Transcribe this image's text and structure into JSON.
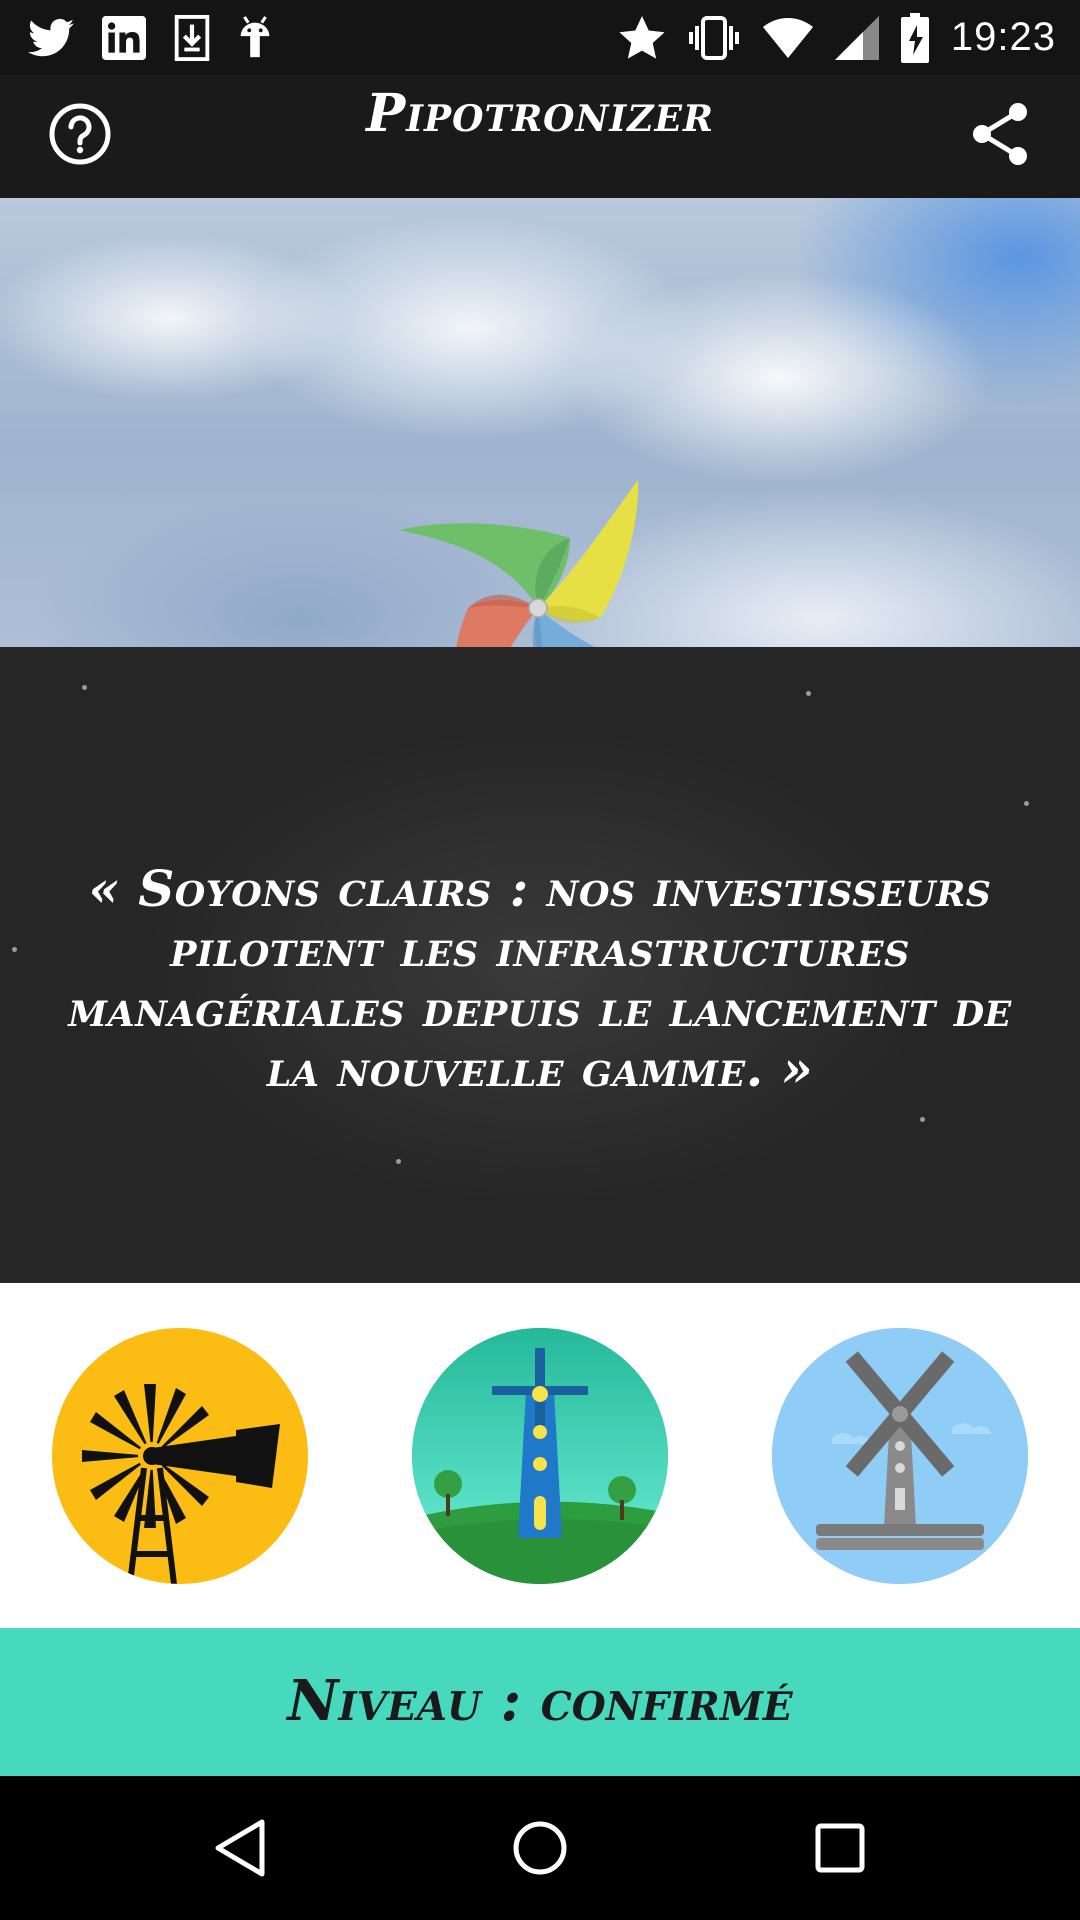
{
  "status_bar": {
    "time": "19:23",
    "icons": [
      "twitter-icon",
      "linkedin-icon",
      "download-icon",
      "android-icon",
      "star-icon",
      "vibrate-icon",
      "wifi-icon",
      "signal-icon",
      "battery-charging-icon"
    ]
  },
  "app_bar": {
    "title": "Pipotronizer",
    "help_icon": "help-circle-icon",
    "share_icon": "share-icon"
  },
  "quote": {
    "text": "« Soyons clairs : nos investisseurs pilotent les infrastructures managériales depuis le lancement de la nouvelle gamme. »"
  },
  "levels": {
    "items": [
      {
        "icon": "windpump-icon",
        "color": "#fbbc13"
      },
      {
        "icon": "lighthouse-windmill-icon",
        "color": "#27c2a5"
      },
      {
        "icon": "windmill-icon",
        "color": "#8fcdf6"
      }
    ]
  },
  "level_banner": {
    "text": "Niveau : confirmé",
    "color": "#47d9bd"
  },
  "nav_bar": {
    "icons": [
      "back-icon",
      "home-icon",
      "recents-icon"
    ]
  }
}
